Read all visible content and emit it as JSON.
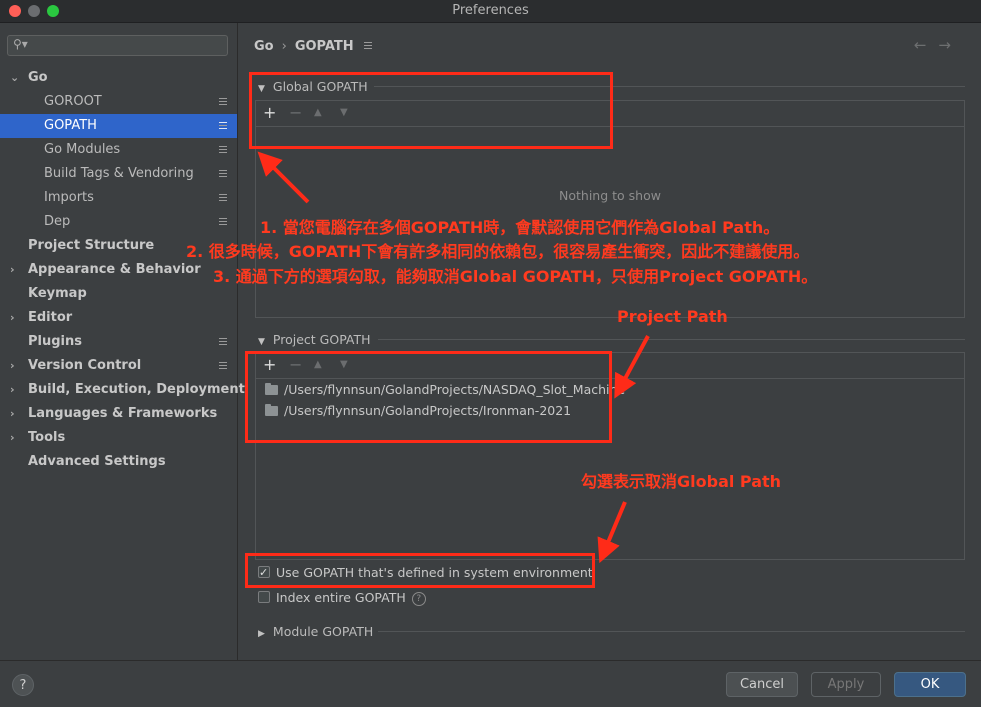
{
  "window": {
    "title": "Preferences"
  },
  "search": {
    "placeholder": ""
  },
  "sidebar": {
    "items": [
      {
        "label": "Go",
        "bold": true,
        "arrow": "⌄"
      },
      {
        "label": "GOROOT"
      },
      {
        "label": "GOPATH",
        "selected": true
      },
      {
        "label": "Go Modules"
      },
      {
        "label": "Build Tags & Vendoring"
      },
      {
        "label": "Imports"
      },
      {
        "label": "Dep"
      },
      {
        "label": "Project Structure",
        "bold": true
      },
      {
        "label": "Appearance & Behavior",
        "bold": true,
        "arrow": "›"
      },
      {
        "label": "Keymap",
        "bold": true
      },
      {
        "label": "Editor",
        "bold": true,
        "arrow": "›"
      },
      {
        "label": "Plugins",
        "bold": true
      },
      {
        "label": "Version Control",
        "bold": true,
        "arrow": "›"
      },
      {
        "label": "Build, Execution, Deployment",
        "bold": true,
        "arrow": "›"
      },
      {
        "label": "Languages & Frameworks",
        "bold": true,
        "arrow": "›"
      },
      {
        "label": "Tools",
        "bold": true,
        "arrow": "›"
      },
      {
        "label": "Advanced Settings",
        "bold": true
      }
    ]
  },
  "breadcrumb": {
    "parent": "Go",
    "separator": "›",
    "current": "GOPATH"
  },
  "nav": {
    "back": "←",
    "forward": "→"
  },
  "global_gopath": {
    "title": "Global GOPATH",
    "empty_text": "Nothing to show",
    "toolbar": {
      "add": "+",
      "remove": "−",
      "up": "▲",
      "down": "▼"
    }
  },
  "project_gopath": {
    "title": "Project GOPATH",
    "toolbar": {
      "add": "+",
      "remove": "−",
      "up": "▲",
      "down": "▼"
    },
    "paths": [
      "/Users/flynnsun/GolandProjects/NASDAQ_Slot_Machine",
      "/Users/flynnsun/GolandProjects/Ironman-2021"
    ]
  },
  "options": {
    "use_system_gopath": {
      "label": "Use GOPATH that's defined in system environment",
      "checked": true
    },
    "index_entire_gopath": {
      "label": "Index entire GOPATH",
      "checked": false,
      "help": "?"
    }
  },
  "module_gopath": {
    "title": "Module GOPATH"
  },
  "footer": {
    "help": "?",
    "cancel": "Cancel",
    "apply": "Apply",
    "ok": "OK"
  },
  "annotations": {
    "note1": "1. 當您電腦存在多個GOPATH時，會默認使用它們作為Global Path。",
    "note2": "2. 很多時候，GOPATH下會有許多相同的依賴包，很容易產生衝突，因此不建議使用。",
    "note3": "3. 通過下方的選項勾取，能夠取消Global GOPATH，只使用Project GOPATH。",
    "project_path": "Project Path",
    "checkbox_note": "勾選表示取消Global Path",
    "color": "#ff2b18"
  },
  "colors": {
    "selection": "#2f65ca",
    "background": "#3c3f41",
    "ok_button": "#365880"
  }
}
